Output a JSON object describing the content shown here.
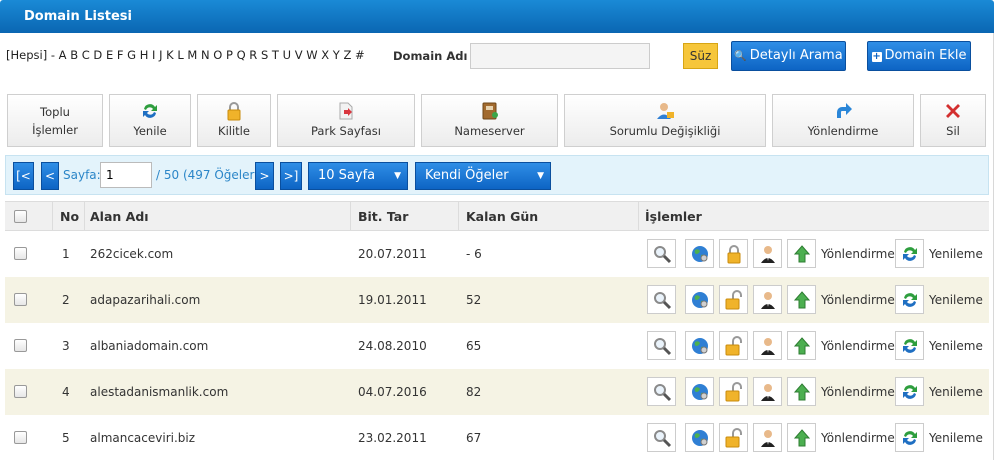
{
  "window": {
    "title": "Domain Listesi"
  },
  "alphabet": {
    "all": "[Hepsi]",
    "letters": [
      "A",
      "B",
      "C",
      "D",
      "E",
      "F",
      "G",
      "H",
      "I",
      "J",
      "K",
      "L",
      "M",
      "N",
      "O",
      "P",
      "Q",
      "R",
      "S",
      "T",
      "U",
      "V",
      "W",
      "X",
      "Y",
      "Z",
      "#"
    ]
  },
  "search": {
    "label": "Domain Adı",
    "value": "",
    "filter_button": "Süz",
    "advanced_button": "Detaylı Arama",
    "add_button": "Domain Ekle"
  },
  "toolbar": {
    "bulk_line1": "Toplu",
    "bulk_line2": "İşlemler",
    "refresh": "Yenile",
    "lock": "Kilitle",
    "park": "Park Sayfası",
    "nameserver": "Nameserver",
    "contact": "Sorumlu Değişikliği",
    "redirect": "Yönlendirme",
    "delete": "Sil"
  },
  "pager": {
    "first": "[<",
    "prev": "<",
    "next": ">",
    "last": ">]",
    "page_label": "Sayfa:",
    "page_value": "1",
    "summary": "/ 50 (497 Öğeler)",
    "per_page": "10 Sayfa",
    "filter": "Kendi Öğeler"
  },
  "table": {
    "headers": {
      "no": "No",
      "domain": "Alan Adı",
      "expiry": "Bit. Tar",
      "remaining": "Kalan Gün",
      "actions": "İşlemler"
    },
    "action_labels": {
      "redirect": "Yönlendirme",
      "renew": "Yenileme"
    },
    "rows": [
      {
        "no": "1",
        "domain": "262cicek.com",
        "expiry": "20.07.2011",
        "remaining": "- 6",
        "locked": true
      },
      {
        "no": "2",
        "domain": "adapazarihali.com",
        "expiry": "19.01.2011",
        "remaining": "52",
        "locked": false
      },
      {
        "no": "3",
        "domain": "albaniadomain.com",
        "expiry": "24.08.2010",
        "remaining": "65",
        "locked": false
      },
      {
        "no": "4",
        "domain": "alestadanismanlik.com",
        "expiry": "04.07.2016",
        "remaining": "82",
        "locked": false
      },
      {
        "no": "5",
        "domain": "almancaceviri.biz",
        "expiry": "23.02.2011",
        "remaining": "67",
        "locked": false
      }
    ]
  },
  "icons": {
    "toolbar": [
      "refresh-icon",
      "padlock-icon",
      "park-page-icon",
      "nameserver-book-icon",
      "contact-person-icon",
      "redirect-arrow-icon",
      "delete-x-icon"
    ],
    "row_actions": [
      "magnifier-icon",
      "globe-icon",
      "padlock-icon",
      "person-icon",
      "up-arrow-icon",
      "refresh-icon"
    ]
  },
  "colors": {
    "titlebar": "#0a66b2",
    "accent_blue": "#0d64c4",
    "filter_yellow": "#f6c63a",
    "alt_row": "#f5f3e4",
    "pager_bg": "#e3f3fb"
  }
}
